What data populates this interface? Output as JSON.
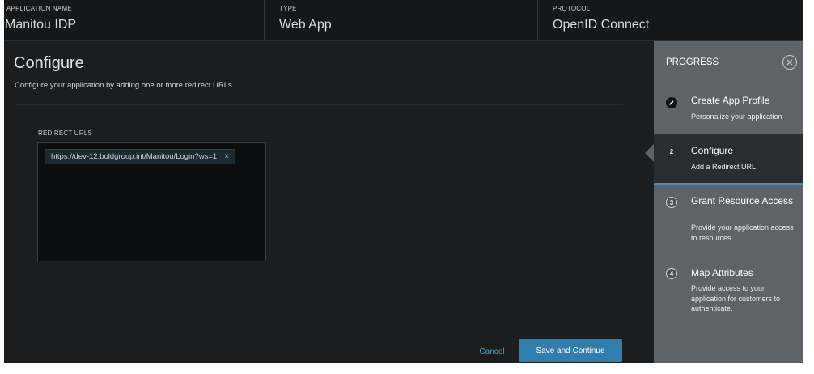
{
  "header": {
    "application_name_label": "APPLICATION NAME",
    "application_name": "Manitou IDP",
    "type_label": "TYPE",
    "type": "Web App",
    "protocol_label": "PROTOCOL",
    "protocol": "OpenID Connect"
  },
  "main": {
    "title": "Configure",
    "description": "Configure your application by adding one or more redirect URLs.",
    "redirect_urls_label": "REDIRECT URLS",
    "redirect_urls": [
      "https://dev-12.boldgroup.int/Manitou/Login?ws=1"
    ],
    "remove_glyph": "×",
    "cancel_label": "Cancel",
    "save_label": "Save and Continue"
  },
  "progress": {
    "title": "PROGRESS",
    "steps": [
      {
        "badge": "",
        "title": "Create App Profile",
        "description": "Personalize your application",
        "state": "done",
        "icon": "pencil-icon"
      },
      {
        "badge": "2",
        "title": "Configure",
        "description": "Add a Redirect URL",
        "state": "current"
      },
      {
        "badge": "3",
        "title": "Grant Resource Access",
        "description": "Provide your application access to resources.",
        "state": "pending"
      },
      {
        "badge": "4",
        "title": "Map Attributes",
        "description": "Provide access to your application for customers to authenticate.",
        "state": "pending"
      }
    ]
  },
  "colors": {
    "accent": "#2e7fae",
    "link": "#4a9fd1",
    "panel": "#5d6366",
    "background": "#1b1d1e"
  }
}
